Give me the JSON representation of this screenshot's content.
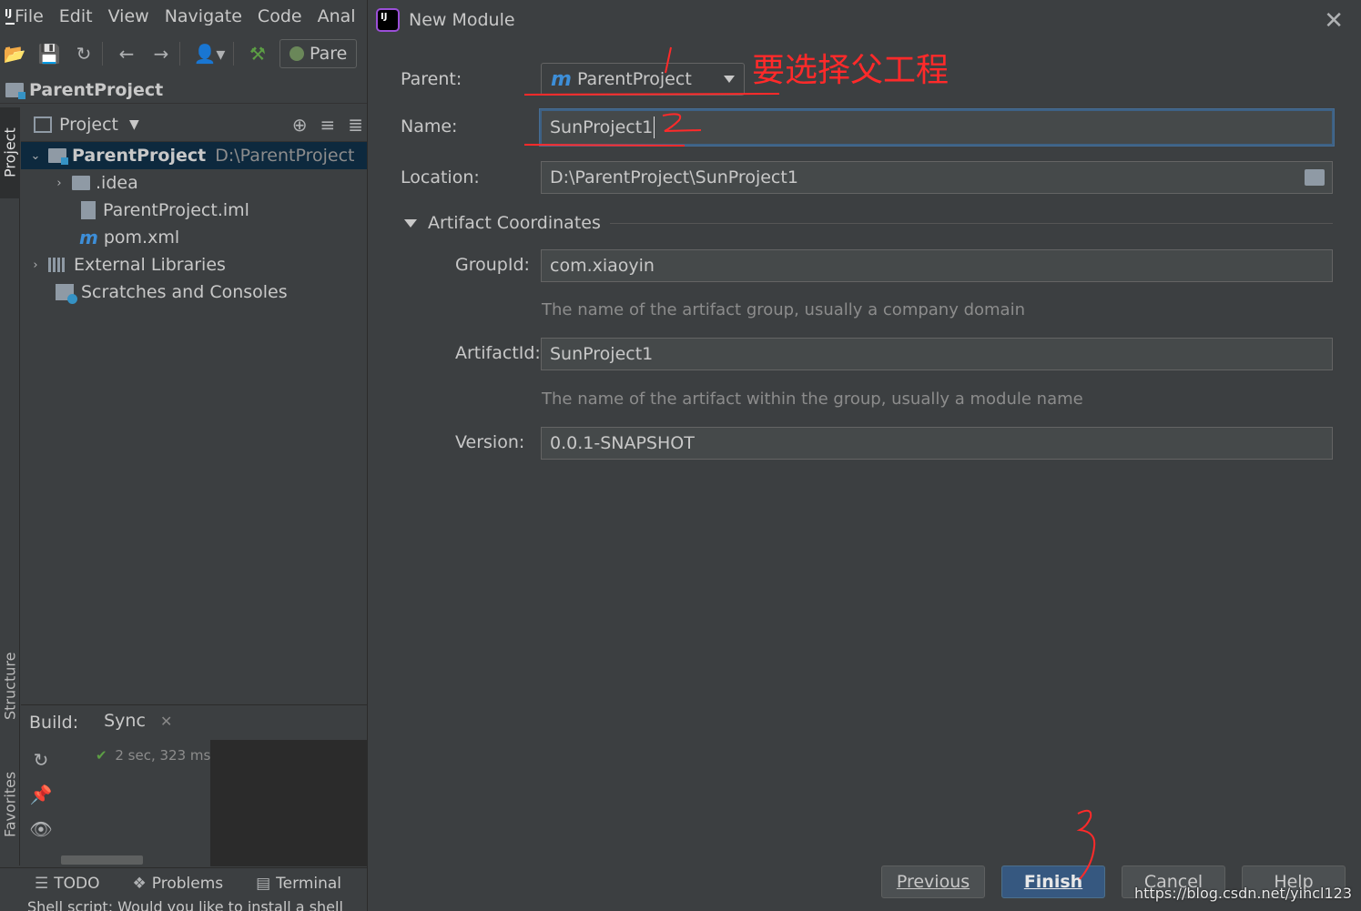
{
  "ide": {
    "menu": [
      "File",
      "Edit",
      "View",
      "Navigate",
      "Code",
      "Anal"
    ],
    "run_config": "Pare",
    "breadcrumb": "ParentProject",
    "side_tabs": {
      "project": "Project",
      "structure": "Structure",
      "favorites": "Favorites"
    },
    "project_panel": {
      "title": "Project",
      "tree": [
        {
          "label": "ParentProject",
          "path": "D:\\ParentProject"
        },
        {
          "label": ".idea"
        },
        {
          "label": "ParentProject.iml"
        },
        {
          "label": "pom.xml"
        },
        {
          "label": "External Libraries"
        },
        {
          "label": "Scratches and Consoles"
        }
      ]
    },
    "build": {
      "label": "Build:",
      "tab": "Sync",
      "status": "2 sec, 323 ms"
    },
    "bottom_tabs": [
      "TODO",
      "Problems",
      "Terminal"
    ],
    "status_message": "Shell script: Would you like to install a shell"
  },
  "dialog": {
    "title": "New Module",
    "labels": {
      "parent": "Parent:",
      "name": "Name:",
      "location": "Location:",
      "group_id": "GroupId:",
      "artifact_id": "ArtifactId:",
      "version": "Version:"
    },
    "parent_value": "ParentProject",
    "name_value": "SunProject1",
    "location_value": "D:\\ParentProject\\SunProject1",
    "section_title": "Artifact Coordinates",
    "group_id_value": "com.xiaoyin",
    "group_id_hint": "The name of the artifact group, usually a company domain",
    "artifact_id_value": "SunProject1",
    "artifact_id_hint": "The name of the artifact within the group, usually a module name",
    "version_value": "0.0.1-SNAPSHOT",
    "buttons": {
      "previous": "Previous",
      "finish": "Finish",
      "cancel": "Cancel",
      "help": "Help"
    }
  },
  "annotation": {
    "note": "要选择父工程",
    "color": "#ff2a2a"
  },
  "watermark": "https://blog.csdn.net/yincl123",
  "colors": {
    "background": "#3c3f41",
    "primary_button": "#365880",
    "selection": "#0d293e",
    "focus_border": "#3d6185"
  }
}
